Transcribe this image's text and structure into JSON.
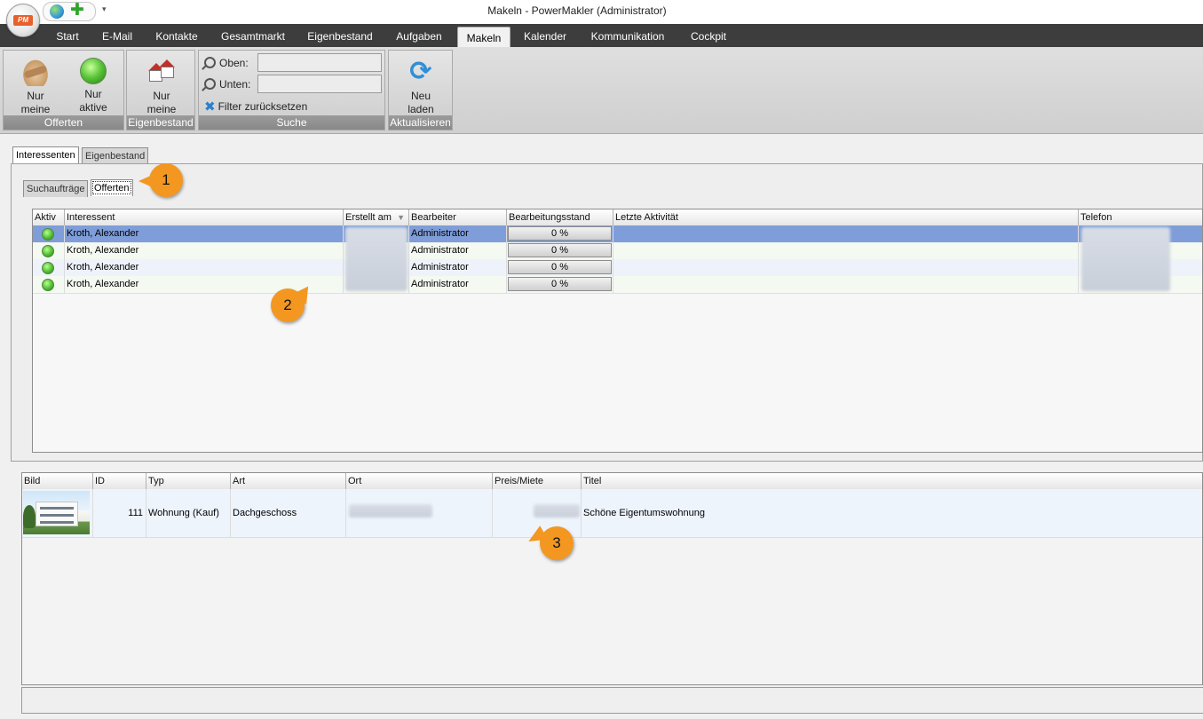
{
  "window": {
    "title": "Makeln - PowerMakler (Administrator)",
    "app_logo_text": "PM"
  },
  "ribbon_tabs": [
    {
      "label": "Start",
      "active": false
    },
    {
      "label": "E-Mail",
      "active": false
    },
    {
      "label": "Kontakte",
      "active": false
    },
    {
      "label": "Gesamtmarkt",
      "active": false
    },
    {
      "label": "Eigenbestand",
      "active": false
    },
    {
      "label": "Aufgaben",
      "active": false
    },
    {
      "label": "Makeln",
      "active": true
    },
    {
      "label": "Kalender",
      "active": false
    },
    {
      "label": "Kommunikation",
      "active": false
    },
    {
      "label": "Cockpit",
      "active": false
    }
  ],
  "ribbon": {
    "offerten": {
      "label": "Offerten",
      "nur_meine": "Nur meine",
      "nur_meine_l1": "Nur",
      "nur_meine_l2": "meine",
      "nur_aktive_l1": "Nur",
      "nur_aktive_l2": "aktive"
    },
    "eigenbestand": {
      "label": "Eigenbestand",
      "nur_meine_l1": "Nur",
      "nur_meine_l2": "meine"
    },
    "suche": {
      "label": "Suche",
      "oben_label": "Oben:",
      "oben_value": "",
      "unten_label": "Unten:",
      "unten_value": "",
      "reset_label": "Filter zurücksetzen"
    },
    "aktualisieren": {
      "label": "Aktualisieren",
      "neu_l1": "Neu",
      "neu_l2": "laden"
    }
  },
  "main_tabs": [
    {
      "label": "Interessenten",
      "selected": true
    },
    {
      "label": "Eigenbestand",
      "selected": false
    }
  ],
  "sub_tabs": [
    {
      "label": "Suchaufträge",
      "selected": false
    },
    {
      "label": "Offerten",
      "selected": true
    }
  ],
  "callouts": [
    "1",
    "2",
    "3"
  ],
  "interessenten_grid": {
    "columns": [
      "Aktiv",
      "Interessent",
      "Erstellt am",
      "Bearbeiter",
      "Bearbeitungsstand",
      "Letzte Aktivität",
      "Telefon"
    ],
    "rows": [
      {
        "aktiv": true,
        "interessent": "Kroth, Alexander",
        "bearbeiter": "Administrator",
        "stand": "0 %",
        "letzte": "",
        "selected": true
      },
      {
        "aktiv": true,
        "interessent": "Kroth, Alexander",
        "bearbeiter": "Administrator",
        "stand": "0 %",
        "letzte": "",
        "selected": false
      },
      {
        "aktiv": true,
        "interessent": "Kroth, Alexander",
        "bearbeiter": "Administrator",
        "stand": "0 %",
        "letzte": "",
        "selected": false
      },
      {
        "aktiv": true,
        "interessent": "Kroth, Alexander",
        "bearbeiter": "Administrator",
        "stand": "0 %",
        "letzte": "",
        "selected": false
      }
    ]
  },
  "objekte_grid": {
    "columns": [
      "Bild",
      "ID",
      "Typ",
      "Art",
      "Ort",
      "Preis/Miete",
      "Titel"
    ],
    "rows": [
      {
        "id": "111",
        "typ": "Wohnung (Kauf)",
        "art": "Dachgeschoss",
        "titel": "Schöne Eigentumswohnung"
      }
    ]
  },
  "colors": {
    "ribbon_tab_bar": "#3d3d3d",
    "selected_row": "#7f9dd9",
    "callout": "#f39720",
    "status_active": "#53be34"
  }
}
